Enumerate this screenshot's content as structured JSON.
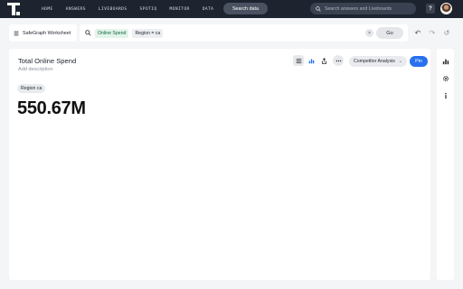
{
  "nav": {
    "links": [
      "HOME",
      "ANSWERS",
      "LIVEBOARDS",
      "SPOTIQ",
      "MONITOR",
      "DATA"
    ],
    "search_data_label": "Search data",
    "global_search_placeholder": "Search answers and Liveboards",
    "help_label": "?"
  },
  "search": {
    "source_label": "SafeGraph Worksheet",
    "tokens": [
      {
        "label": "Online Spend",
        "kind": "measure"
      },
      {
        "label": "Region = ca",
        "kind": "filter"
      }
    ],
    "clear_label": "×",
    "go_label": "Go"
  },
  "answer": {
    "title": "Total Online Spend",
    "description_placeholder": "Add description",
    "filter_chip": "Region ca",
    "kpi_value": "550.67M",
    "dropdown_label": "Competitor Analysis",
    "pin_label": "Pin"
  },
  "colors": {
    "nav_bg": "#1d232f",
    "accent": "#2770ef",
    "measure_token_bg": "#e2f3ea",
    "measure_token_text": "#10683d"
  },
  "icons": {
    "source": "worksheet-icon",
    "search": "search-icon",
    "undo": "undo-icon",
    "redo": "redo-icon",
    "reset": "reset-icon",
    "table": "table-view-icon",
    "chart": "chart-view-icon",
    "share": "share-icon",
    "more": "more-icon",
    "rail": [
      "chart-settings-icon",
      "gear-icon",
      "info-icon"
    ]
  }
}
